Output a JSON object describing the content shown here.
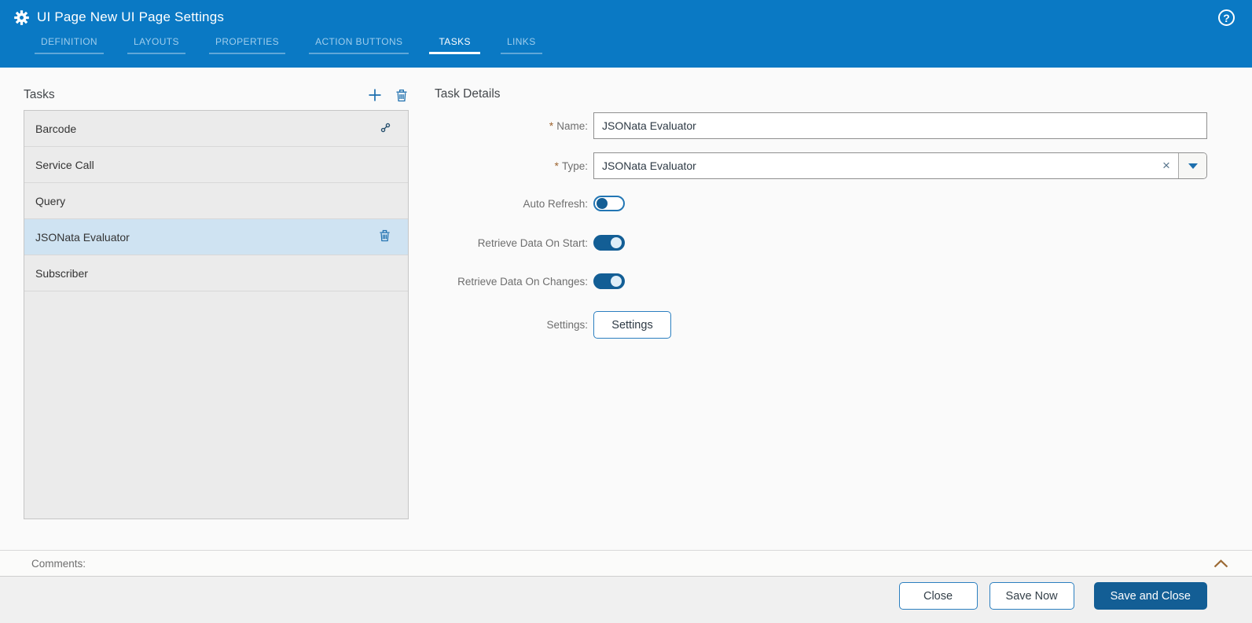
{
  "header": {
    "title": "UI Page New UI Page Settings",
    "help_glyph": "?",
    "tabs": [
      {
        "label": "DEFINITION",
        "active": false
      },
      {
        "label": "LAYOUTS",
        "active": false
      },
      {
        "label": "PROPERTIES",
        "active": false
      },
      {
        "label": "ACTION BUTTONS",
        "active": false
      },
      {
        "label": "TASKS",
        "active": true
      },
      {
        "label": "LINKS",
        "active": false
      }
    ]
  },
  "tasks_panel": {
    "title": "Tasks",
    "actions": [
      {
        "icon": "add-task-icon"
      },
      {
        "icon": "delete-task-icon"
      }
    ],
    "items": [
      {
        "label": "Barcode",
        "icon": "link-icon",
        "selected": false
      },
      {
        "label": "Service Call",
        "icon": null,
        "selected": false
      },
      {
        "label": "Query",
        "icon": null,
        "selected": false
      },
      {
        "label": "JSONata Evaluator",
        "icon": "trash-icon",
        "selected": true
      },
      {
        "label": "Subscriber",
        "icon": null,
        "selected": false
      }
    ]
  },
  "details": {
    "title": "Task Details",
    "required_marker": "*",
    "fields": {
      "name": {
        "label": "Name:",
        "required": true,
        "value": "JSONata Evaluator"
      },
      "type": {
        "label": "Type:",
        "required": true,
        "value": "JSONata Evaluator",
        "clear_glyph": "×"
      },
      "auto_refresh": {
        "label": "Auto Refresh:",
        "value": false
      },
      "retrieve_start": {
        "label": "Retrieve Data On Start:",
        "value": true
      },
      "retrieve_changes": {
        "label": "Retrieve Data On Changes:",
        "value": true
      },
      "settings": {
        "label": "Settings:",
        "button_label": "Settings"
      }
    }
  },
  "comments": {
    "label": "Comments:"
  },
  "footer": {
    "close_label": "Close",
    "save_now_label": "Save Now",
    "save_and_close_label": "Save and Close"
  },
  "colors": {
    "header_blue": "#0a79c4",
    "accent_blue": "#1d6fae",
    "dark_blue": "#135e95",
    "selected_row": "#cfe3f2",
    "amber_accent": "#9c6a34",
    "required_marker": "#9c622e"
  }
}
